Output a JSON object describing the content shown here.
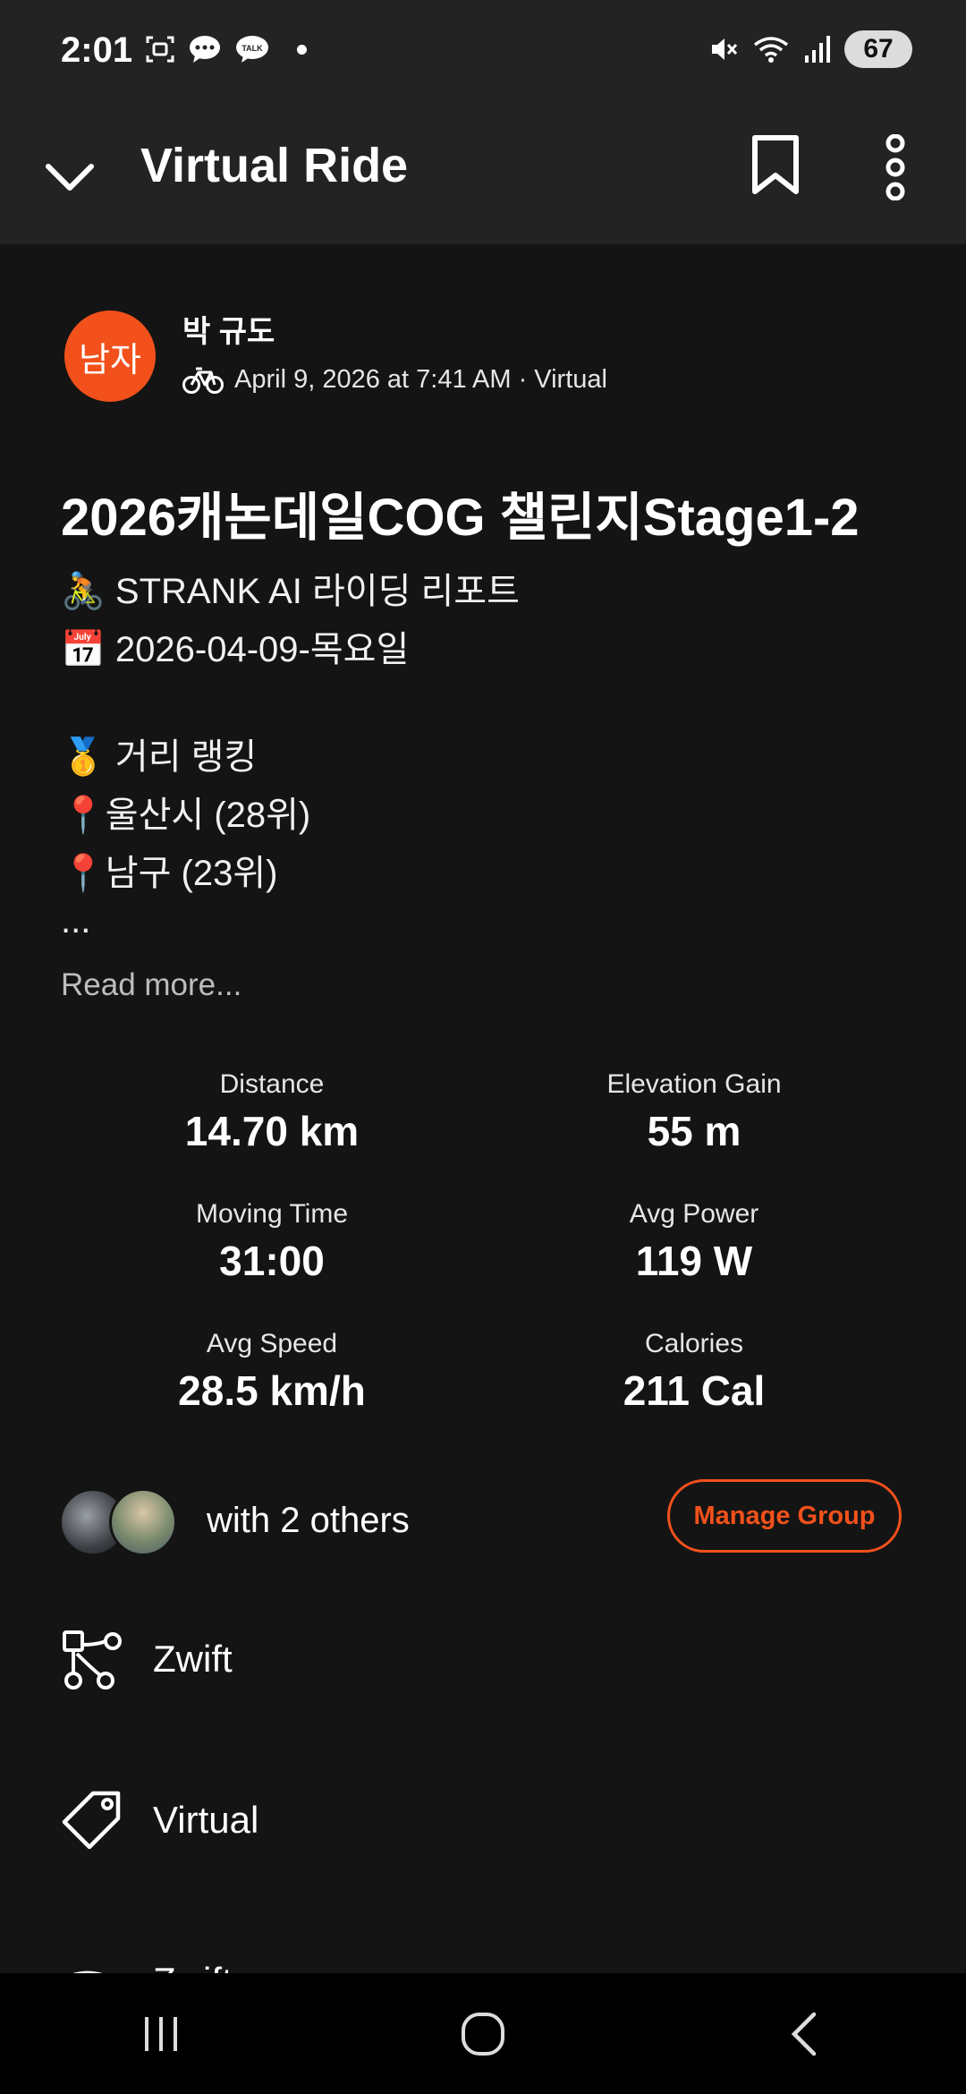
{
  "status": {
    "time": "2:01",
    "battery": "67"
  },
  "header": {
    "title": "Virtual Ride"
  },
  "athlete": {
    "avatar_text": "남자",
    "name": "박 규도",
    "meta": "April 9, 2026 at 7:41 AM · Virtual"
  },
  "activity": {
    "title": "2026캐논데일COG 챌린지Stage1-2",
    "description": [
      "🚴 STRANK AI 라이딩 리포트",
      "📅 2026-04-09-목요일",
      "",
      "🥇 거리 랭킹",
      "📍울산시 (28위)",
      "📍남구 (23위)",
      "..."
    ],
    "read_more": "Read more..."
  },
  "stats": [
    {
      "label": "Distance",
      "value": "14.70 km"
    },
    {
      "label": "Elevation Gain",
      "value": "55 m"
    },
    {
      "label": "Moving Time",
      "value": "31:00"
    },
    {
      "label": "Avg Power",
      "value": "119 W"
    },
    {
      "label": "Avg Speed",
      "value": "28.5 km/h"
    },
    {
      "label": "Calories",
      "value": "211 Cal"
    }
  ],
  "group": {
    "with_text": "with 2 others",
    "manage_label": "Manage Group"
  },
  "list": [
    {
      "label": "Zwift",
      "icon": "route-icon"
    },
    {
      "label": "Virtual",
      "icon": "tag-icon"
    },
    {
      "label": "Zwift",
      "icon": "signal-icon"
    }
  ],
  "colors": {
    "accent": "#f2511b",
    "background": "#141414",
    "header": "#232323"
  }
}
